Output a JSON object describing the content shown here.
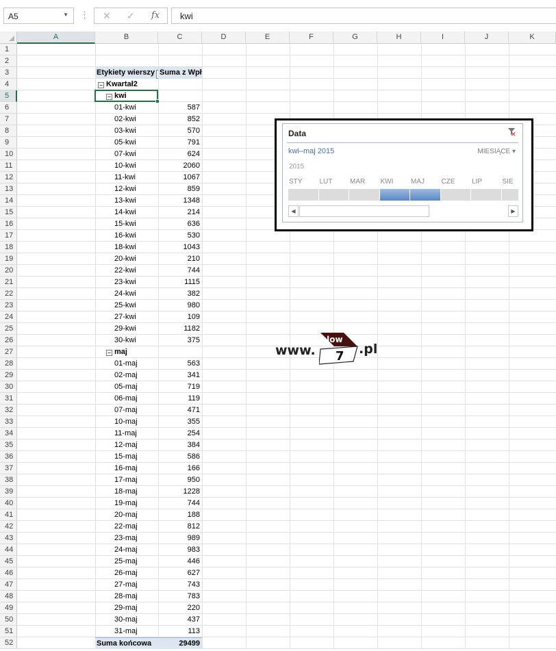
{
  "formula_bar": {
    "name_box": "A5",
    "name_box_arrow": "▼",
    "separator": "⋮",
    "cancel_icon": "✕",
    "enter_icon": "✓",
    "function_icon": "fx",
    "formula": "kwi"
  },
  "grid": {
    "active_cell": "A5",
    "columns": [
      "A",
      "B",
      "C",
      "D",
      "E",
      "F",
      "G",
      "H",
      "I",
      "J",
      "K"
    ],
    "row_numbers": [
      "1",
      "2",
      "3",
      "4",
      "5",
      "6",
      "7",
      "8",
      "9",
      "10",
      "11",
      "12",
      "13",
      "14",
      "15",
      "16",
      "17",
      "18",
      "19",
      "20",
      "21",
      "22",
      "23",
      "24",
      "25",
      "26",
      "27",
      "28",
      "29",
      "30",
      "31",
      "32",
      "33",
      "34",
      "35",
      "36",
      "37",
      "38",
      "39",
      "40",
      "41",
      "42",
      "43",
      "44",
      "45",
      "46",
      "47",
      "48",
      "49",
      "50",
      "51",
      "52"
    ]
  },
  "pivot": {
    "row_labels_header": "Etykiety wierszy",
    "values_header": "Suma z Wpływy",
    "filter_icon": "filter-dropdown-icon",
    "collapse_icon": "minus-box-icon",
    "quarter": "Kwartał2",
    "months": [
      {
        "label": "kwi",
        "rows": [
          {
            "date": "01-kwi",
            "value": "587"
          },
          {
            "date": "02-kwi",
            "value": "852"
          },
          {
            "date": "03-kwi",
            "value": "570"
          },
          {
            "date": "05-kwi",
            "value": "791"
          },
          {
            "date": "07-kwi",
            "value": "624"
          },
          {
            "date": "10-kwi",
            "value": "2060"
          },
          {
            "date": "11-kwi",
            "value": "1067"
          },
          {
            "date": "12-kwi",
            "value": "859"
          },
          {
            "date": "13-kwi",
            "value": "1348"
          },
          {
            "date": "14-kwi",
            "value": "214"
          },
          {
            "date": "15-kwi",
            "value": "636"
          },
          {
            "date": "16-kwi",
            "value": "530"
          },
          {
            "date": "18-kwi",
            "value": "1043"
          },
          {
            "date": "20-kwi",
            "value": "210"
          },
          {
            "date": "22-kwi",
            "value": "744"
          },
          {
            "date": "23-kwi",
            "value": "1115"
          },
          {
            "date": "24-kwi",
            "value": "382"
          },
          {
            "date": "25-kwi",
            "value": "980"
          },
          {
            "date": "27-kwi",
            "value": "109"
          },
          {
            "date": "29-kwi",
            "value": "1182"
          },
          {
            "date": "30-kwi",
            "value": "375"
          }
        ]
      },
      {
        "label": "maj",
        "rows": [
          {
            "date": "01-maj",
            "value": "563"
          },
          {
            "date": "02-maj",
            "value": "341"
          },
          {
            "date": "05-maj",
            "value": "719"
          },
          {
            "date": "06-maj",
            "value": "119"
          },
          {
            "date": "07-maj",
            "value": "471"
          },
          {
            "date": "10-maj",
            "value": "355"
          },
          {
            "date": "11-maj",
            "value": "254"
          },
          {
            "date": "12-maj",
            "value": "384"
          },
          {
            "date": "15-maj",
            "value": "586"
          },
          {
            "date": "16-maj",
            "value": "166"
          },
          {
            "date": "17-maj",
            "value": "950"
          },
          {
            "date": "18-maj",
            "value": "1228"
          },
          {
            "date": "19-maj",
            "value": "744"
          },
          {
            "date": "20-maj",
            "value": "188"
          },
          {
            "date": "22-maj",
            "value": "812"
          },
          {
            "date": "23-maj",
            "value": "989"
          },
          {
            "date": "24-maj",
            "value": "983"
          },
          {
            "date": "25-maj",
            "value": "446"
          },
          {
            "date": "26-maj",
            "value": "627"
          },
          {
            "date": "27-maj",
            "value": "743"
          },
          {
            "date": "28-maj",
            "value": "783"
          },
          {
            "date": "29-maj",
            "value": "220"
          },
          {
            "date": "30-maj",
            "value": "437"
          },
          {
            "date": "31-maj",
            "value": "113"
          }
        ]
      }
    ],
    "total_label": "Suma końcowa",
    "total_value": "29499"
  },
  "slicer": {
    "title": "Data",
    "clear_filter_icon": "clear-filter-icon",
    "selected_range": "kwi–maj 2015",
    "time_level": "MIESIĄCE",
    "time_level_arrow": "▾",
    "year": "2015",
    "months": [
      "STY",
      "LUT",
      "MAR",
      "KWI",
      "MAJ",
      "CZE",
      "LIP",
      "SIE"
    ],
    "selected_months": [
      "KWI",
      "MAJ"
    ],
    "scroll_left": "◀",
    "scroll_right": "▶"
  },
  "watermark": {
    "prefix": "www.",
    "badge_top": "slow",
    "badge_bottom": "7",
    "suffix": ".pl",
    "badge_color": "#4a1010"
  }
}
